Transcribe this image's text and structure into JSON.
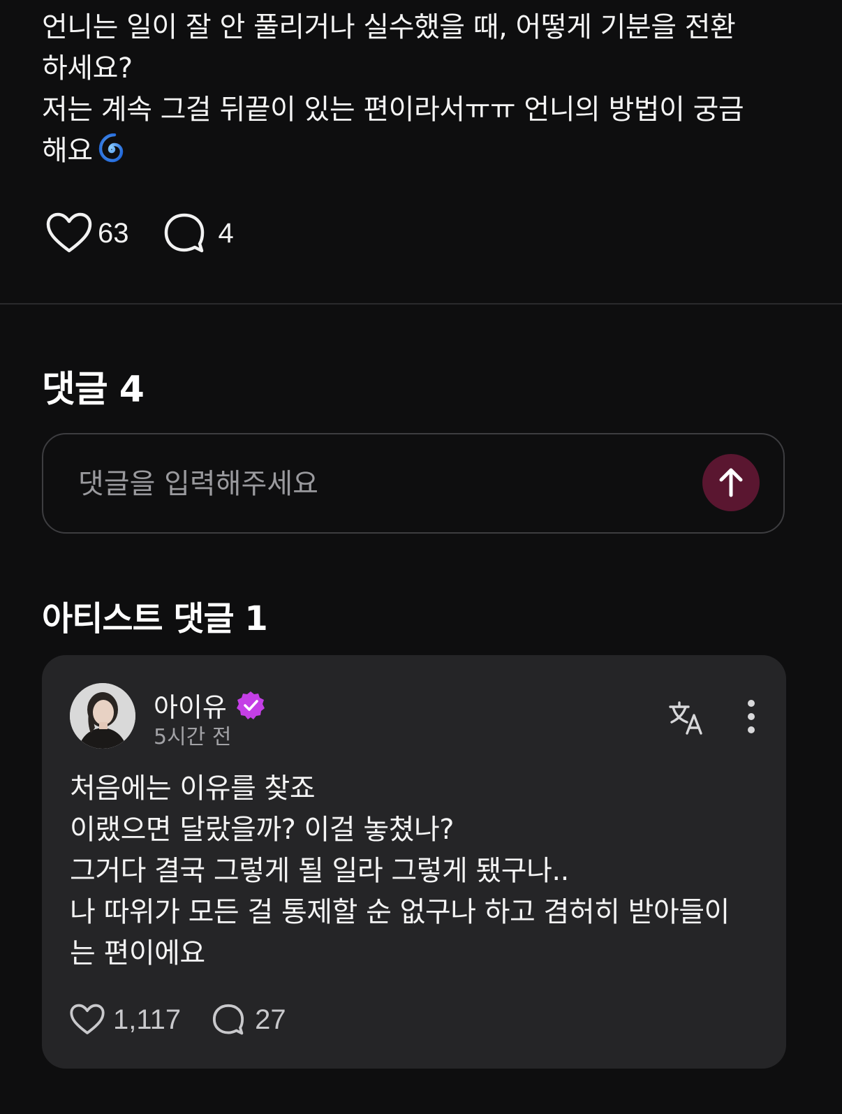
{
  "post": {
    "lines": [
      "언니는 일이 잘 안 풀리거나 실수했을 때, 어떻게 기분을 전환",
      "하세요?",
      "저는 계속 그걸 뒤끝이 있는 편이라서ㅠㅠ 언니의 방법이 궁금",
      "해요"
    ],
    "emoji_icon": "cyclone-emoji",
    "like_count": "63",
    "comment_count": "4"
  },
  "comments": {
    "title": "댓글 4",
    "input_placeholder": "댓글을 입력해주세요",
    "send_icon": "arrow-up-icon"
  },
  "artist_comments": {
    "title": "아티스트 댓글 1",
    "items": [
      {
        "author": "아이유",
        "verified": true,
        "time": "5시간 전",
        "lines": [
          "처음에는 이유를 찾죠",
          "이랬으면 달랐을까? 이걸 놓쳤나?",
          "그거다 결국 그렇게 될 일라 그렇게 됐구나..",
          "나 따위가 모든 걸 통제할 순 없구나 하고 겸허히 받아들이",
          "는 편이에요"
        ],
        "like_count": "1,117",
        "reply_count": "27"
      }
    ]
  },
  "colors": {
    "background": "#0e0e0f",
    "card": "#252527",
    "send_button": "#5a1630",
    "verified_badge": "#c43fe6"
  }
}
